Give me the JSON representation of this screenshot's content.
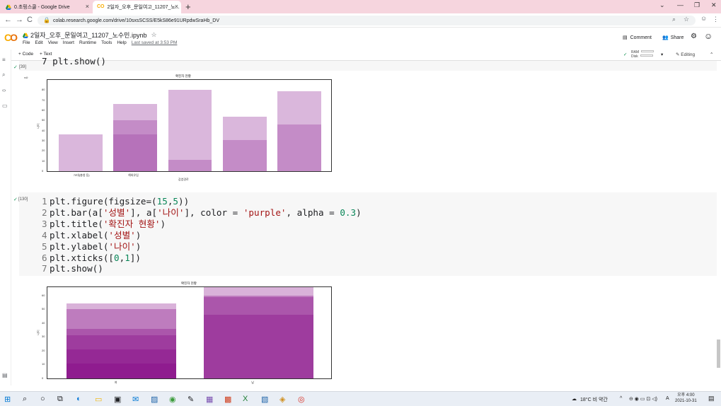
{
  "browser": {
    "tab1_title": "0.초핑스쿨 - Google Drive",
    "tab2_title": "2일자_오후_문일여고_11207_노...",
    "url": "colab.research.google.com/drive/10sxsSCSS/E5kS86e91URpdwSraHb_DV"
  },
  "header": {
    "notebook_title": "2일자_오후_문일여고_11207_노수민.ipynb",
    "menus": [
      "File",
      "Edit",
      "View",
      "Insert",
      "Runtime",
      "Tools",
      "Help"
    ],
    "saved": "Last saved at 3:53 PM",
    "comment_label": "Comment",
    "share_label": "Share"
  },
  "toolbar": {
    "code_label": "+ Code",
    "text_label": "+ Text",
    "ram_label": "RAM",
    "disk_label": "Disk",
    "editing_label": "Editing"
  },
  "cell1": {
    "partial_code": "7 plt.show()",
    "exec_label": "[39]"
  },
  "cell2": {
    "exec_label": "[130]",
    "lines": [
      {
        "n": "1",
        "parts": [
          {
            "t": "plt.figure(figsize=(",
            "c": "kw"
          },
          {
            "t": "15",
            "c": "num"
          },
          {
            "t": ",",
            "c": "kw"
          },
          {
            "t": "5",
            "c": "num"
          },
          {
            "t": "))",
            "c": "kw"
          }
        ]
      },
      {
        "n": "2",
        "parts": [
          {
            "t": "plt.bar(a[",
            "c": "kw"
          },
          {
            "t": "'성별'",
            "c": "str"
          },
          {
            "t": "], a[",
            "c": "kw"
          },
          {
            "t": "'나이'",
            "c": "str"
          },
          {
            "t": "], color = ",
            "c": "kw"
          },
          {
            "t": "'purple'",
            "c": "str"
          },
          {
            "t": ", alpha = ",
            "c": "kw"
          },
          {
            "t": "0.3",
            "c": "num"
          },
          {
            "t": ")",
            "c": "kw"
          }
        ]
      },
      {
        "n": "3",
        "parts": [
          {
            "t": "plt.title(",
            "c": "kw"
          },
          {
            "t": "'확진자 현황'",
            "c": "str"
          },
          {
            "t": ")",
            "c": "kw"
          }
        ]
      },
      {
        "n": "4",
        "parts": [
          {
            "t": "plt.xlabel(",
            "c": "kw"
          },
          {
            "t": "'성별'",
            "c": "str"
          },
          {
            "t": ")",
            "c": "kw"
          }
        ]
      },
      {
        "n": "5",
        "parts": [
          {
            "t": "plt.ylabel(",
            "c": "kw"
          },
          {
            "t": "'나이'",
            "c": "str"
          },
          {
            "t": ")",
            "c": "kw"
          }
        ]
      },
      {
        "n": "6",
        "parts": [
          {
            "t": "plt.xticks([",
            "c": "kw"
          },
          {
            "t": "0",
            "c": "num"
          },
          {
            "t": ",",
            "c": "kw"
          },
          {
            "t": "1",
            "c": "num"
          },
          {
            "t": "])",
            "c": "kw"
          }
        ]
      },
      {
        "n": "7",
        "parts": [
          {
            "t": "plt.show()",
            "c": "kw"
          }
        ]
      }
    ]
  },
  "chart_data": [
    {
      "type": "bar",
      "title": "확진자 현황",
      "xlabel": "감염경로",
      "ylabel": "나이",
      "ylim": [
        0,
        90
      ],
      "yticks": [
        0,
        10,
        20,
        30,
        40,
        50,
        60,
        70,
        80
      ],
      "xtick_labels": [
        "70대(충청 등)",
        "해외유입",
        "",
        "",
        ""
      ],
      "color": "#c78fc9",
      "stacks": [
        [
          36
        ],
        [
          36,
          50,
          66
        ],
        [
          11,
          80
        ],
        [
          31,
          54
        ],
        [
          46,
          79
        ]
      ]
    },
    {
      "type": "bar",
      "title": "확진자 현황",
      "xlabel": "성별",
      "ylabel": "나이",
      "ylim": [
        0,
        66
      ],
      "yticks": [
        0,
        10,
        20,
        30,
        40,
        50,
        60
      ],
      "xtick_labels": [
        "여",
        "남"
      ],
      "color": "purple",
      "stacks": [
        [
          11,
          21,
          31,
          36,
          50,
          54
        ],
        [
          46,
          59,
          60,
          66
        ]
      ]
    }
  ],
  "taskbar": {
    "weather": "18°C 비 약간",
    "ime": "A",
    "time": "오후 4:00",
    "date": "2021-10-31"
  }
}
